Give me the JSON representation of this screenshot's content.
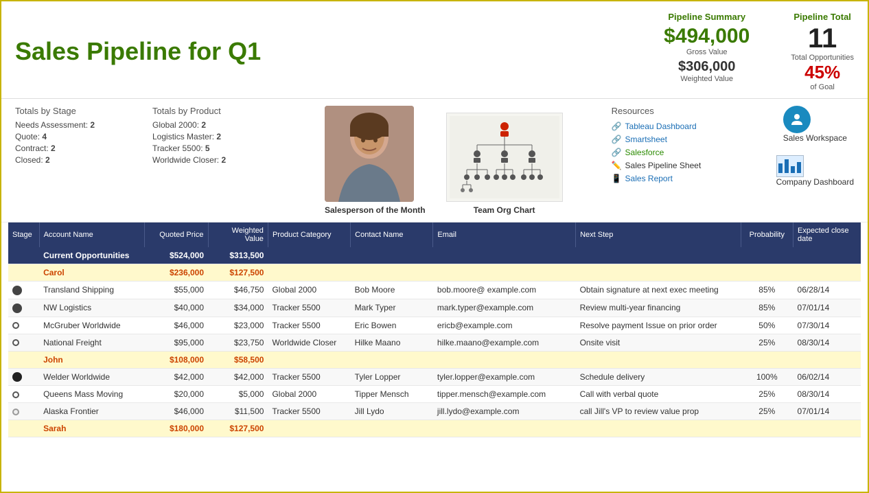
{
  "title": "Sales Pipeline for Q1",
  "pipeline_summary": {
    "label": "Pipeline Summary",
    "gross_value": "$494,000",
    "gross_label": "Gross Value",
    "weighted_value": "$306,000",
    "weighted_label": "Weighted Value"
  },
  "pipeline_total": {
    "label": "Pipeline Total",
    "total_num": "11",
    "total_label": "Total Opportunities",
    "goal_pct": "45%",
    "goal_label": "of Goal"
  },
  "totals_by_stage": {
    "header": "Totals by Stage",
    "items": [
      {
        "label": "Needs Assessment:",
        "value": "2"
      },
      {
        "label": "Quote:",
        "value": "4"
      },
      {
        "label": "Contract:",
        "value": "2"
      },
      {
        "label": "Closed:",
        "value": "2"
      }
    ]
  },
  "totals_by_product": {
    "header": "Totals by Product",
    "items": [
      {
        "label": "Global 2000:",
        "value": "2"
      },
      {
        "label": "Logistics Master:",
        "value": "2"
      },
      {
        "label": "Tracker 5500:",
        "value": "5"
      },
      {
        "label": "Worldwide Closer:",
        "value": "2"
      }
    ]
  },
  "salesperson_caption": "Salesperson of the Month",
  "org_caption": "Team Org Chart",
  "resources": {
    "header": "Resources",
    "items": [
      {
        "label": "Tableau Dashboard",
        "icon": "chain",
        "color": "blue"
      },
      {
        "label": "Smartsheet",
        "icon": "chain",
        "color": "blue"
      },
      {
        "label": "Salesforce",
        "icon": "chain",
        "color": "green"
      },
      {
        "label": "Sales Pipeline Sheet",
        "icon": "pencil",
        "color": "dark"
      },
      {
        "label": "Sales Report",
        "icon": "phone",
        "color": "blue"
      }
    ]
  },
  "workspace_label": "Sales Workspace",
  "dashboard_label": "Company Dashboard",
  "table": {
    "headers": [
      "Stage",
      "Account Name",
      "Quoted Price",
      "Weighted Value",
      "Product Category",
      "Contact Name",
      "Email",
      "Next Step",
      "Probability",
      "Expected close date"
    ],
    "group1": {
      "label": "Current Opportunities",
      "quoted": "$524,000",
      "weighted": "$313,500"
    },
    "sub1": {
      "name": "Carol",
      "quoted": "$236,000",
      "weighted": "$127,500"
    },
    "rows1": [
      {
        "stage_icon": "half",
        "account": "Transland Shipping",
        "quoted": "$55,000",
        "weighted": "$46,750",
        "product": "Global 2000",
        "contact": "Bob Moore",
        "email": "bob.moore@ example.com",
        "next_step": "Obtain signature at next exec meeting",
        "prob": "85%",
        "close": "06/28/14"
      },
      {
        "stage_icon": "half",
        "account": "NW Logistics",
        "quoted": "$40,000",
        "weighted": "$34,000",
        "product": "Tracker 5500",
        "contact": "Mark Typer",
        "email": "mark.typer@example.com",
        "next_step": "Review multi-year financing",
        "prob": "85%",
        "close": "07/01/14"
      },
      {
        "stage_icon": "dark",
        "account": "McGruber Worldwide",
        "quoted": "$46,000",
        "weighted": "$23,000",
        "product": "Tracker 5500",
        "contact": "Eric Bowen",
        "email": "ericb@example.com",
        "next_step": "Resolve payment issue on prior order",
        "prob": "50%",
        "close": "07/30/14"
      },
      {
        "stage_icon": "dark",
        "account": "National Freight",
        "quoted": "$95,000",
        "weighted": "$23,750",
        "product": "Worldwide Closer",
        "contact": "Hilke Maano",
        "email": "hilke.maano@example.com",
        "next_step": "Onsite visit",
        "prob": "25%",
        "close": "08/30/14"
      }
    ],
    "sub2": {
      "name": "John",
      "quoted": "$108,000",
      "weighted": "$58,500"
    },
    "rows2": [
      {
        "stage_icon": "filled",
        "account": "Welder Worldwide",
        "quoted": "$42,000",
        "weighted": "$42,000",
        "product": "Tracker 5500",
        "contact": "Tyler Lopper",
        "email": "tyler.lopper@example.com",
        "next_step": "Schedule delivery",
        "prob": "100%",
        "close": "06/02/14"
      },
      {
        "stage_icon": "light",
        "account": "Queens Mass Moving",
        "quoted": "$20,000",
        "weighted": "$5,000",
        "product": "Global 2000",
        "contact": "Tipper Mensch",
        "email": "tipper.mensch@example.com",
        "next_step": "Call with verbal quote",
        "prob": "25%",
        "close": "08/30/14"
      },
      {
        "stage_icon": "light",
        "account": "Alaska Frontier",
        "quoted": "$46,000",
        "weighted": "$11,500",
        "product": "Tracker 5500",
        "contact": "Jill Lydo",
        "email": "jill.lydo@example.com",
        "next_step": "call Jill's VP to review value prop",
        "prob": "25%",
        "close": "07/01/14"
      }
    ],
    "sub3": {
      "name": "Sarah",
      "quoted": "$180,000",
      "weighted": "$127,500"
    }
  }
}
